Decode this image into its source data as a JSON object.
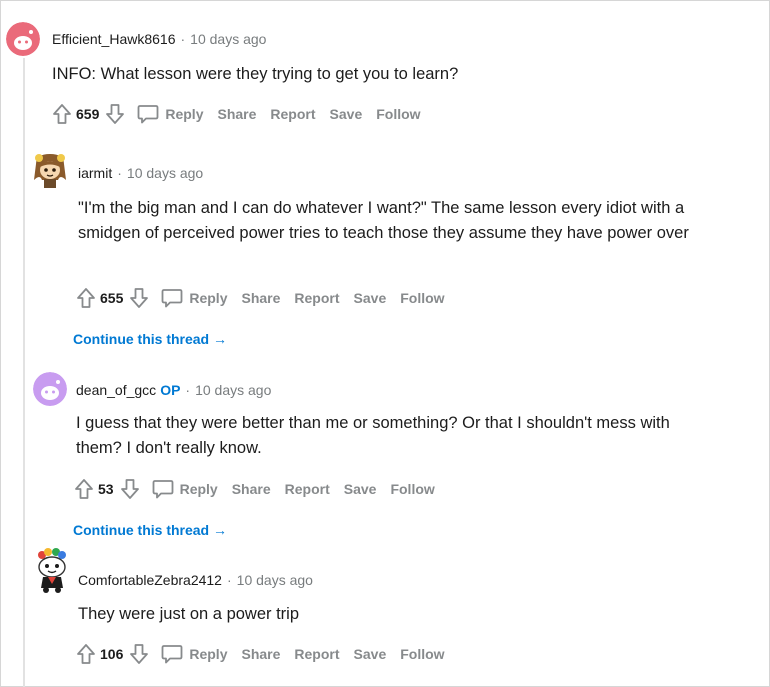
{
  "comments": [
    {
      "username": "Efficient_Hawk8616",
      "op_badge": "",
      "time": "10 days ago",
      "text": "INFO: What lesson were they trying to get you to learn?",
      "votes": "659",
      "avatar_color": "#ea6a7a"
    },
    {
      "username": "iarmit",
      "op_badge": "",
      "time": "10 days ago",
      "text": "\"I'm the big man and I can do whatever I want?\" The same lesson every idiot with a smidgen of perceived power tries to teach those they assume they have power over",
      "votes": "655",
      "continue_label": "Continue this thread →"
    },
    {
      "username": "dean_of_gcc",
      "op_badge": "OP",
      "time": "10 days ago",
      "text": "I guess that they were better than me or something? Or that I shouldn't mess with them? I don't really know.",
      "votes": "53",
      "avatar_color": "#c89cf0",
      "continue_label": "Continue this thread →"
    },
    {
      "username": "ComfortableZebra2412",
      "op_badge": "",
      "time": "10 days ago",
      "text": "They were just on a power trip",
      "votes": "106"
    }
  ],
  "actions": {
    "reply": "Reply",
    "share": "Share",
    "report": "Report",
    "save": "Save",
    "follow": "Follow"
  },
  "separator": "·",
  "icons": {
    "upvote": "arrow-up-icon",
    "downvote": "arrow-down-icon",
    "reply": "speech-bubble-icon"
  }
}
